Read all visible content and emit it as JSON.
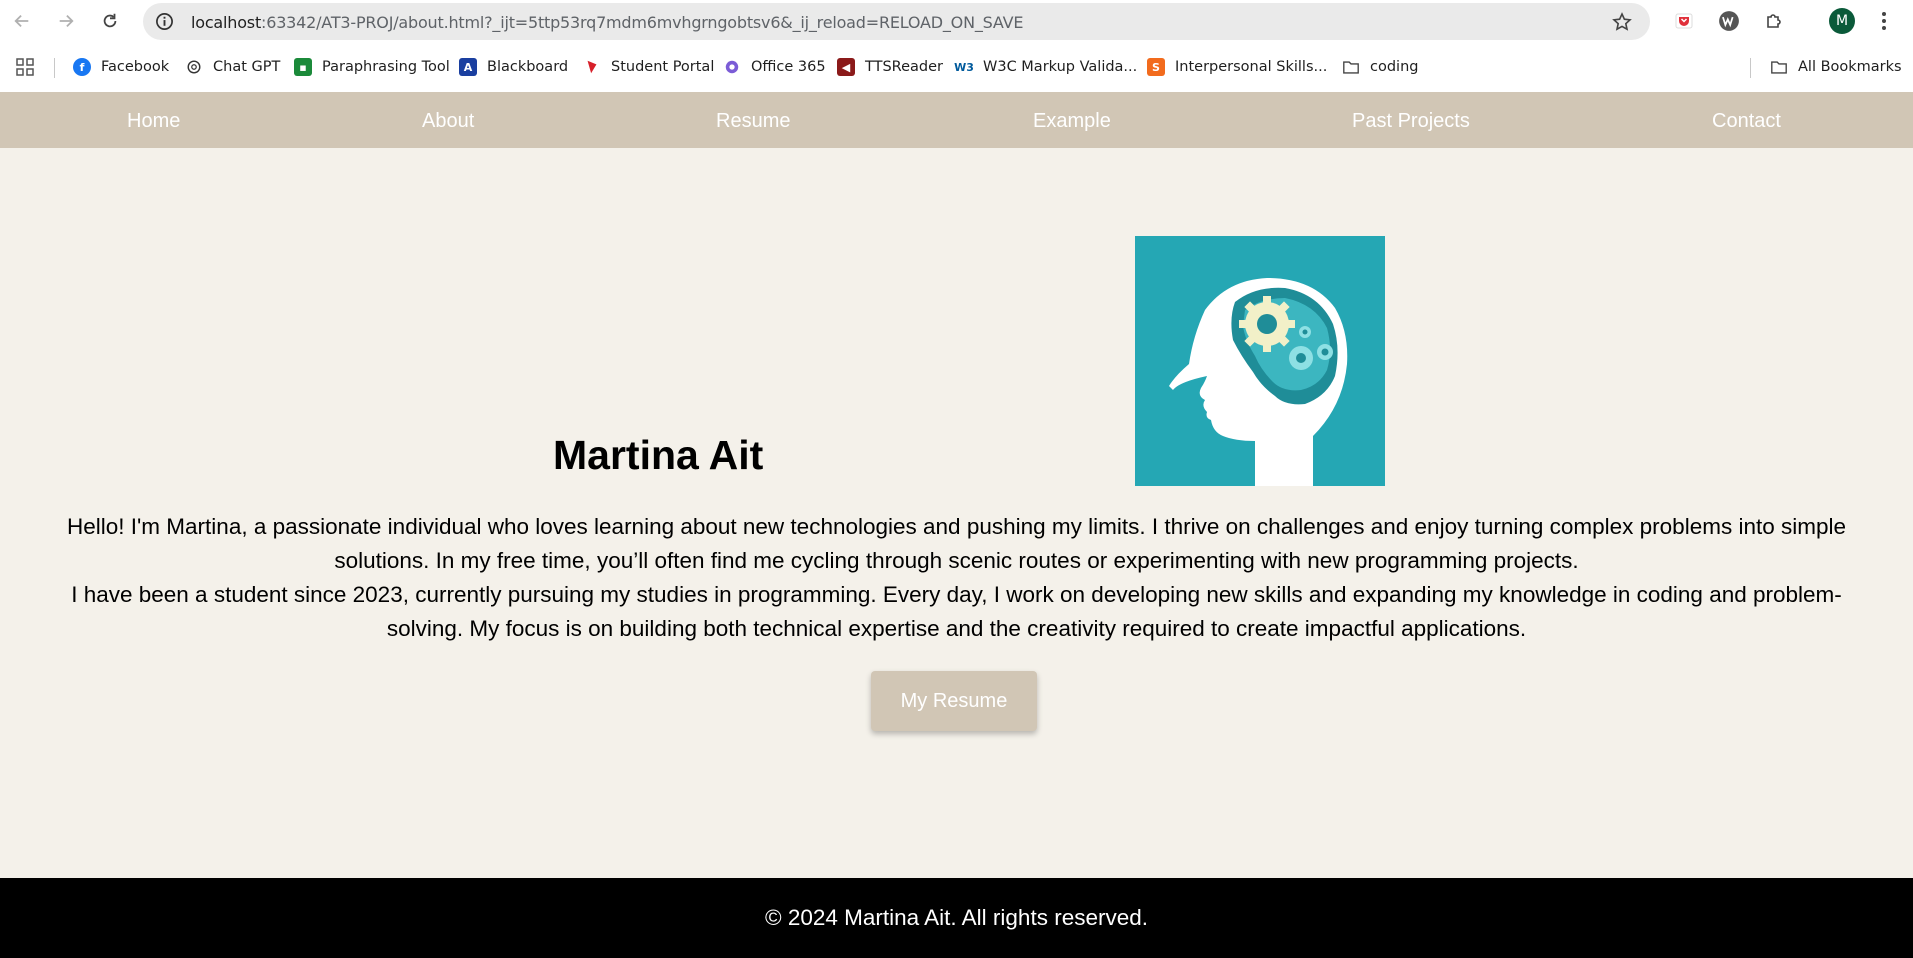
{
  "browser": {
    "url_host": "localhost",
    "url_rest": ":63342/AT3-PROJ/about.html?_ijt=5ttp53rq7mdm6mvhgrngobtsv6&_ij_reload=RELOAD_ON_SAVE",
    "profile_initial": "M",
    "bookmarks": [
      {
        "label": "Facebook",
        "icon": "facebook-icon"
      },
      {
        "label": "Chat GPT",
        "icon": "chatgpt-icon"
      },
      {
        "label": "Paraphrasing Tool",
        "icon": "paraphrasing-tool-icon"
      },
      {
        "label": "Blackboard",
        "icon": "blackboard-icon"
      },
      {
        "label": "Student Portal",
        "icon": "student-portal-icon"
      },
      {
        "label": "Office 365",
        "icon": "office-365-icon"
      },
      {
        "label": "TTSReader",
        "icon": "ttsreader-icon"
      },
      {
        "label": "W3C Markup Valida...",
        "icon": "w3c-icon"
      },
      {
        "label": "Interpersonal Skills...",
        "icon": "interpersonal-skills-icon"
      },
      {
        "label": "coding",
        "icon": "folder-icon"
      }
    ],
    "all_bookmarks": "All Bookmarks"
  },
  "nav": {
    "home": "Home",
    "about": "About",
    "resume": "Resume",
    "example": "Example",
    "past_projects": "Past Projects",
    "contact": "Contact"
  },
  "profile": {
    "name": "Martina Ait",
    "bio_1": "Hello! I'm Martina, a passionate individual who loves learning about new technologies and pushing my limits. I thrive on challenges and enjoy turning complex problems into simple solutions. In my free time, you’ll often find me cycling through scenic routes or experimenting with new programming projects.",
    "bio_2": "I have been a student since 2023, currently pursuing my studies in programming. Every day, I work on developing new skills and expanding my knowledge in coding and problem-solving. My focus is on building both technical expertise and the creativity required to create impactful applications.",
    "resume_button": "My Resume"
  },
  "footer": {
    "text": "© 2024 Martina Ait. All rights reserved."
  },
  "colors": {
    "nav_bg": "#d1c6b5",
    "page_bg": "#f4f1ea",
    "footer_bg": "#000000",
    "image_bg": "#25a7b4"
  }
}
